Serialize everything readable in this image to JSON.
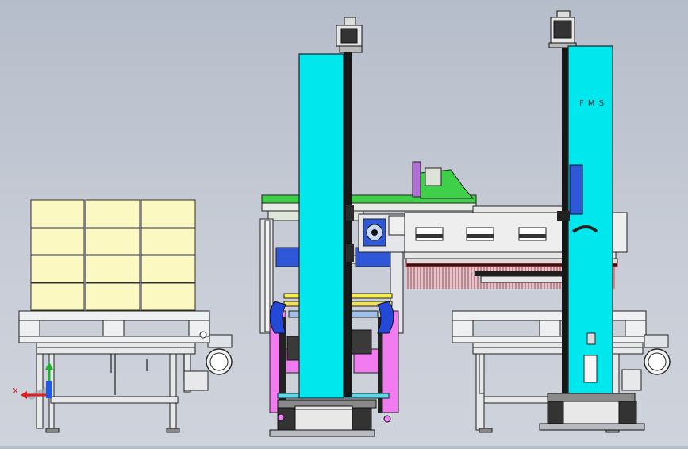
{
  "scene": {
    "column_label": "F M S",
    "axis_label": "X"
  },
  "colors": {
    "background": "#c3c9d3",
    "cyan_column": "#00e8ee",
    "boxes": "#fbf8c1",
    "pallet": "#eef0f2",
    "conveyor_frame": "#e6e8ea",
    "beam": "#eeeeee",
    "green_top": "#3fd04a",
    "magenta_frame": "#f07cf0",
    "blue_plate": "#2e58d8",
    "red_comb": "#e03030",
    "black": "#111111"
  },
  "icons": {
    "axis_triad": "xyz-axis-icon"
  }
}
